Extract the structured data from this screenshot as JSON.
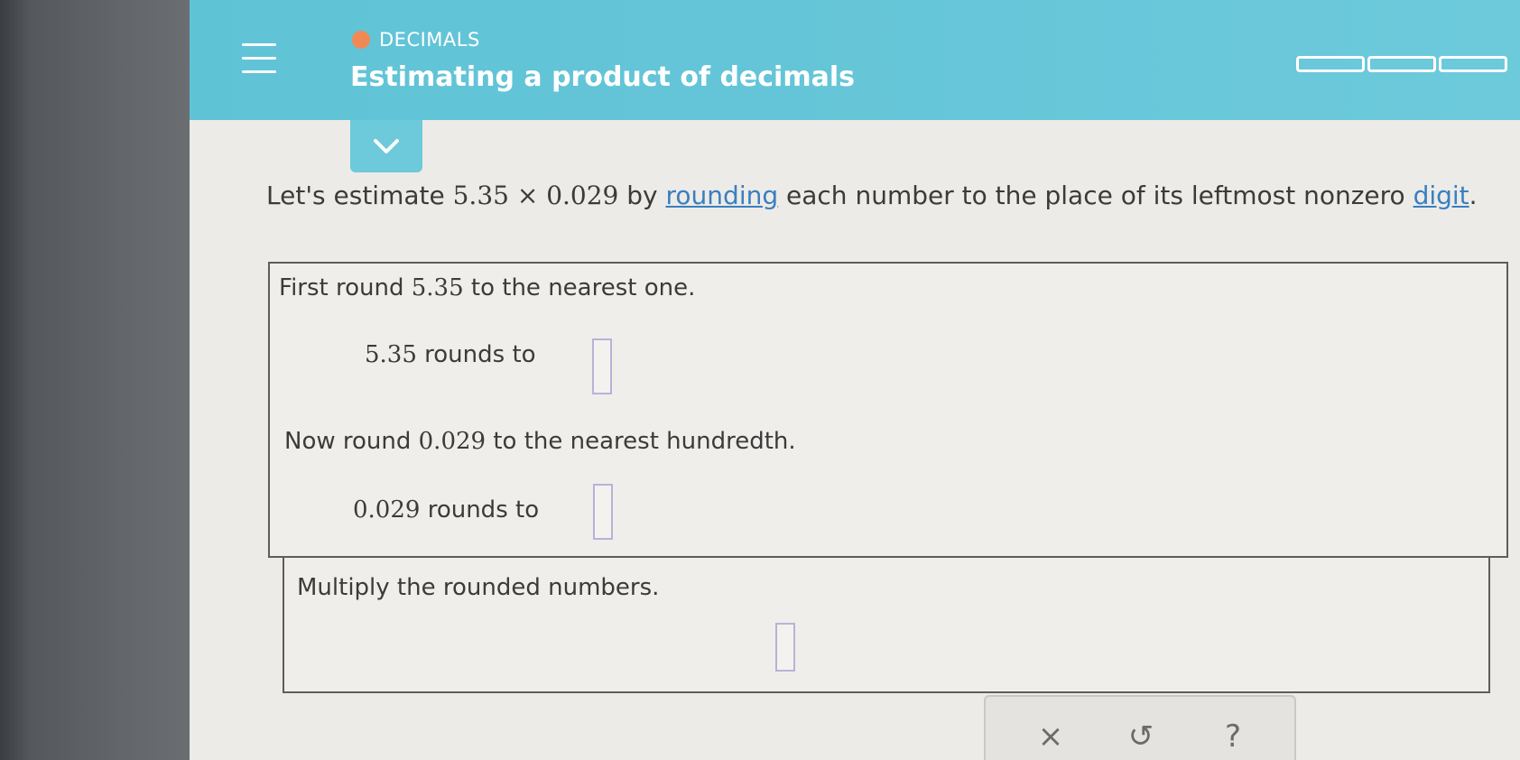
{
  "header": {
    "topic": "DECIMALS",
    "title": "Estimating a product of decimals",
    "topic_dot_color": "#f08a55",
    "background_color": "#67c6d9"
  },
  "instruction": {
    "prefix": "Let's estimate ",
    "expr": "5.35 × 0.029",
    "mid": " by ",
    "link1": "rounding",
    "middle2": " each number to the place of its leftmost nonzero ",
    "link2": "digit",
    "suffix": "."
  },
  "steps": {
    "s1_prefix": "First round ",
    "s1_num": "5.35",
    "s1_suffix": " to the nearest one.",
    "s1_ans_num": "5.35",
    "s1_ans_label": " rounds to",
    "s2_prefix": "Now round ",
    "s2_num": "0.029",
    "s2_suffix": " to the nearest hundredth.",
    "s2_ans_num": "0.029",
    "s2_ans_label": " rounds to",
    "s3_text": "Multiply the rounded numbers."
  },
  "answers": {
    "a1": "",
    "a2": "",
    "a3": ""
  },
  "actions": {
    "clear": "×",
    "undo": "↺",
    "help": "?"
  },
  "icons": {
    "menu": "hamburger-icon",
    "collapse": "chevron-down-icon"
  }
}
